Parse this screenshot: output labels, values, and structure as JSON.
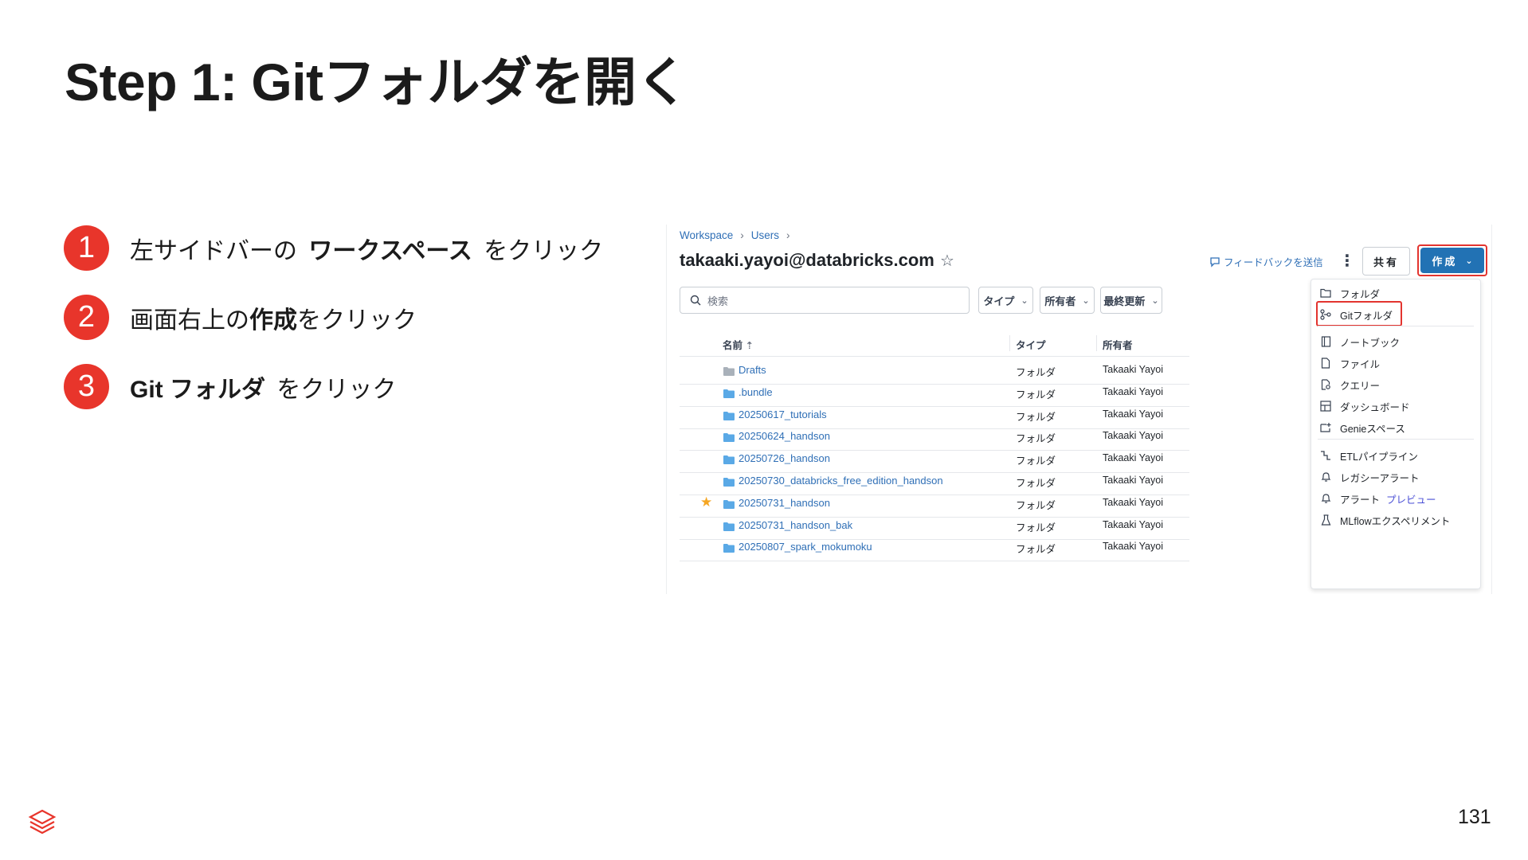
{
  "slide": {
    "title": "Step 1: Gitフォルダを開く",
    "page_number": "131"
  },
  "steps": [
    {
      "num": "1",
      "pre": "左サイドバーの",
      "bold": "ワークスペース",
      "post": "をクリック"
    },
    {
      "num": "2",
      "pre": "画面右上の",
      "bold": "作成",
      "post": "をクリック"
    },
    {
      "num": "3",
      "pre": "",
      "bold": "Git フォルダ",
      "post": "をクリック"
    }
  ],
  "screenshot": {
    "breadcrumb": [
      "Workspace",
      "Users"
    ],
    "title": "takaaki.yayoi@databricks.com",
    "feedback_link": "フィードバックを送信",
    "share_label": "共有",
    "create_label": "作成",
    "search_placeholder": "検索",
    "filters": [
      "タイプ",
      "所有者",
      "最終更新"
    ],
    "columns": {
      "name": "名前",
      "type": "タイプ",
      "owner": "所有者"
    },
    "rows": [
      {
        "name": "Drafts",
        "type": "フォルダ",
        "owner": "Takaaki Yayoi",
        "favorite": false,
        "icon": "folder-gray-icon"
      },
      {
        "name": ".bundle",
        "type": "フォルダ",
        "owner": "Takaaki Yayoi",
        "favorite": false,
        "icon": "folder-icon"
      },
      {
        "name": "20250617_tutorials",
        "type": "フォルダ",
        "owner": "Takaaki Yayoi",
        "favorite": false,
        "icon": "folder-icon"
      },
      {
        "name": "20250624_handson",
        "type": "フォルダ",
        "owner": "Takaaki Yayoi",
        "favorite": false,
        "icon": "folder-icon"
      },
      {
        "name": "20250726_handson",
        "type": "フォルダ",
        "owner": "Takaaki Yayoi",
        "favorite": false,
        "icon": "folder-icon"
      },
      {
        "name": "20250730_databricks_free_edition_handson",
        "type": "フォルダ",
        "owner": "Takaaki Yayoi",
        "favorite": false,
        "icon": "folder-icon"
      },
      {
        "name": "20250731_handson",
        "type": "フォルダ",
        "owner": "Takaaki Yayoi",
        "favorite": true,
        "icon": "folder-icon"
      },
      {
        "name": "20250731_handson_bak",
        "type": "フォルダ",
        "owner": "Takaaki Yayoi",
        "favorite": false,
        "icon": "folder-icon"
      },
      {
        "name": "20250807_spark_mokumoku",
        "type": "フォルダ",
        "owner": "Takaaki Yayoi",
        "favorite": false,
        "icon": "folder-icon"
      }
    ],
    "create_menu": {
      "items": [
        {
          "label": "フォルダ",
          "icon": "folder-outline-icon"
        },
        {
          "label": "Gitフォルダ",
          "icon": "git-icon"
        },
        {
          "label": "ノートブック",
          "icon": "notebook-icon"
        },
        {
          "label": "ファイル",
          "icon": "file-icon"
        },
        {
          "label": "クエリー",
          "icon": "query-icon"
        },
        {
          "label": "ダッシュボード",
          "icon": "dashboard-icon"
        },
        {
          "label": "Genieスペース",
          "icon": "genie-icon"
        },
        {
          "label": "ETLパイプライン",
          "icon": "pipeline-icon"
        },
        {
          "label": "レガシーアラート",
          "icon": "bell-icon"
        },
        {
          "label": "アラート",
          "icon": "bell-icon",
          "badge": "プレビュー"
        },
        {
          "label": "MLflowエクスペリメント",
          "icon": "flask-icon"
        }
      ]
    }
  },
  "colors": {
    "accent_red": "#e8352b",
    "link_blue": "#2f6fb6",
    "button_blue": "#2272b4",
    "folder_blue": "#5aa9e6",
    "highlight_red": "#e3342f"
  }
}
